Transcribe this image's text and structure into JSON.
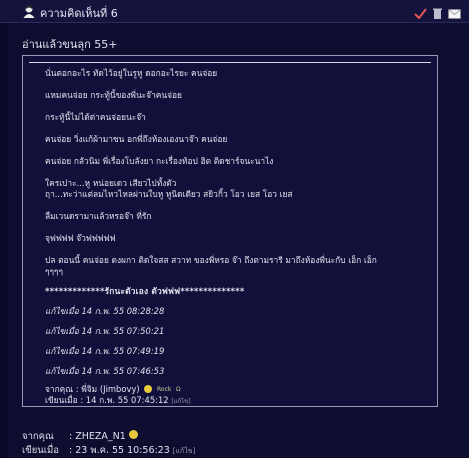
{
  "header": {
    "title": "ความคิดเห็นที่ 6",
    "icons": [
      "avatar-icon",
      "check-icon",
      "trash-icon",
      "mail-icon"
    ]
  },
  "intro_text": "อ่านแล้วขนลุก 55+",
  "quote": {
    "lines": [
      "นั่นตอกอะไร ทัดไว้อยู่ในรูหู ดอกอะไรยะ  คนจ่อย",
      "แหมคนจ่อย  กระทู้นี้ของพี่นะจ๊าคนจ่อย",
      "กระทู้นี้ไม่ได้ด่าคนจ่อยนะจ๊า",
      "คนจ่อย วิ่งแก้ผ้ามาชน อกพี่ถึงห้องเองนาจ๊า คนจ่อย",
      "คนจ่อย กลัวนิม พี่เรื่องโบลังยา กะเรื่องท้อป ฮิต ติดชาร์จนะนาไง",
      "ใครเปาะ...หู หน่อยเดว เสียวไปทั้งตัว\nฤา...ทะว่าแต่ลมไหวไหลผ่านใบหู หูนิดเดียว สยิวกิ้ว  โอว เยส  โอว เยส",
      "ลืมเวนดรามาแล้วหรอจ๊า ที่รัก",
      "จุฟฟฟฟ  จ๊วฟฟฟฟฟ",
      "ปล  ตอนนี้ คนจ่อย ดงผกา ติดใจสส สวาท ของพี่หรอ จ๊า ถึงตามรารี มาถึงห้องพี่นะกับ เอ็ก  เอ็ก\nๆๆๆๆ",
      "*************รักนะตัวเอง  ตัวฟฟฟ**************"
    ],
    "edits": [
      "แก้ไขเมื่อ 14 ก.พ. 55 08:28:28",
      "แก้ไขเมื่อ 14 ก.พ. 55 07:50:21",
      "แก้ไขเมื่อ 14 ก.พ. 55 07:49:19",
      "แก้ไขเมื่อ 14 ก.พ. 55 07:46:53"
    ],
    "from_label": "จากคุณ",
    "from_value": ": พี่จิม (Jimbovy)",
    "badge1": "Rock",
    "badge2": "Ω",
    "written_label": "เขียนเมื่อ",
    "written_value": ": 14 ก.พ. 55 07:45:12",
    "edit_tag": "[แก้ไข]"
  },
  "footer": {
    "from_label": "จากคุณ",
    "from_value": ": ZHEZA_N1",
    "written_label": "เขียนเมื่อ",
    "written_value": ": 23 พ.ค. 55 10:56:23",
    "edit_tag": "[แก้ไข]"
  },
  "colors": {
    "background": "#0d0d30",
    "border": "#9a9ab8",
    "accent": "#e8c93e"
  }
}
